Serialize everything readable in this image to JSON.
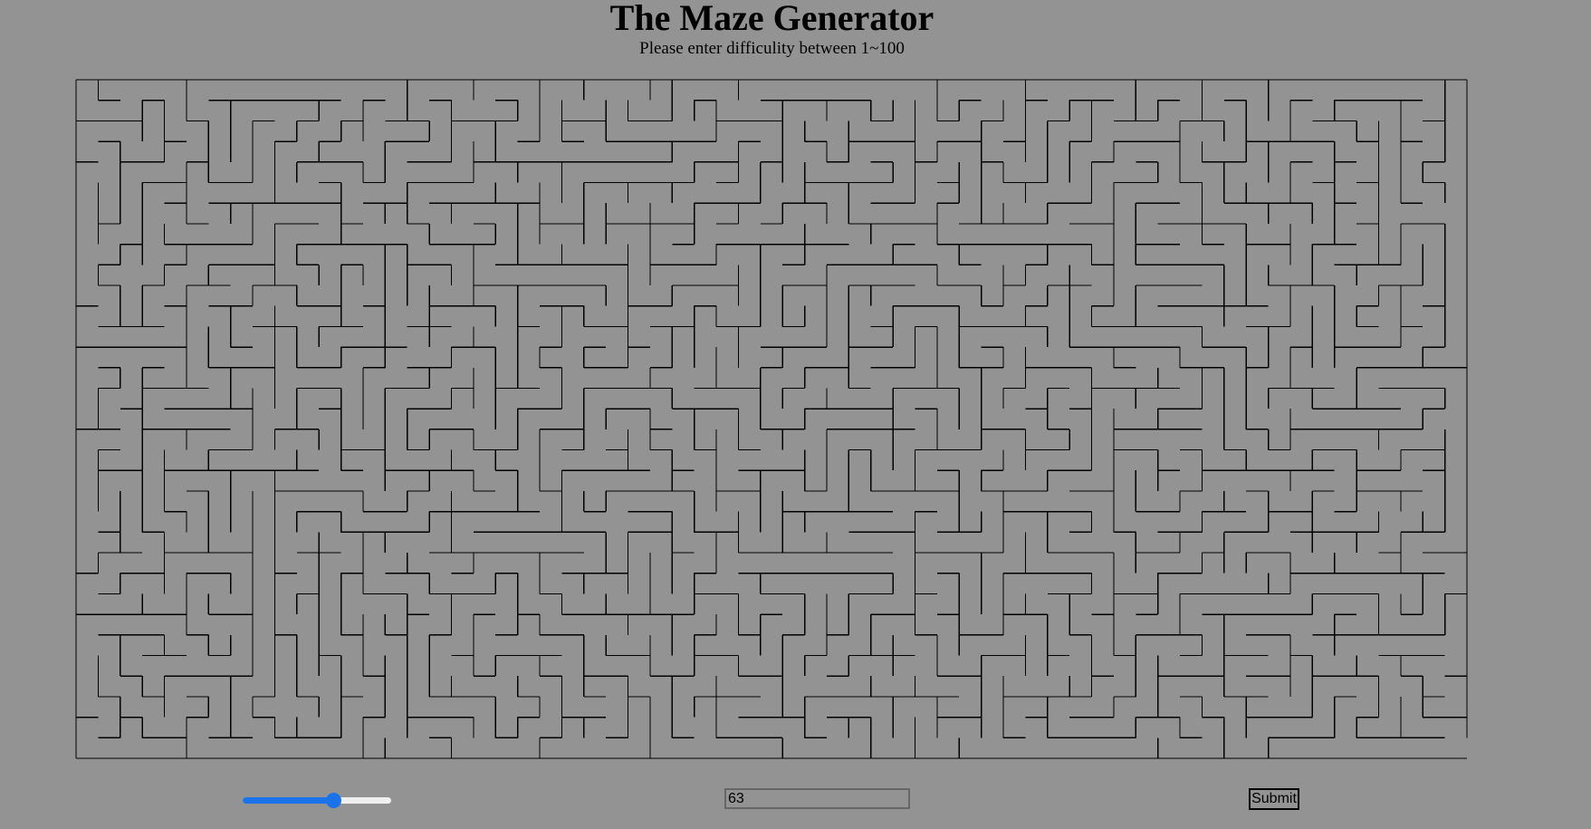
{
  "header": {
    "title": "The Maze Generator",
    "subtitle": "Please enter difficulity between 1~100"
  },
  "controls": {
    "slider_value": 63,
    "slider_min": 1,
    "slider_max": 100,
    "difficulty_value": "63",
    "submit_label": "Submit"
  },
  "maze": {
    "cols": 63,
    "rows": 33,
    "wall_color": "#000000",
    "background_color": "#939393"
  },
  "colors": {
    "accent": "#1a73e8",
    "page_background": "#939393"
  }
}
